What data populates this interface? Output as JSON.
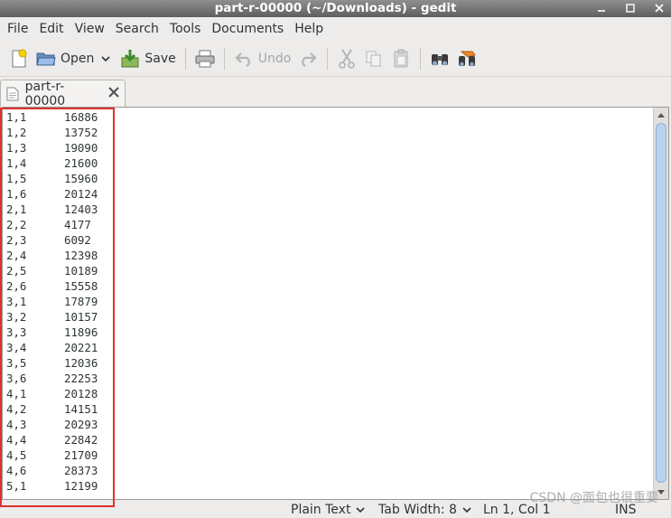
{
  "window": {
    "title": "part-r-00000 (~/Downloads) - gedit"
  },
  "menu": [
    "File",
    "Edit",
    "View",
    "Search",
    "Tools",
    "Documents",
    "Help"
  ],
  "toolbar": {
    "open_label": "Open",
    "save_label": "Save",
    "undo_label": "Undo"
  },
  "tab": {
    "label": "part-r-00000"
  },
  "document": {
    "lines": [
      {
        "k": "1,1",
        "v": "16886"
      },
      {
        "k": "1,2",
        "v": "13752"
      },
      {
        "k": "1,3",
        "v": "19090"
      },
      {
        "k": "1,4",
        "v": "21600"
      },
      {
        "k": "1,5",
        "v": "15960"
      },
      {
        "k": "1,6",
        "v": "20124"
      },
      {
        "k": "2,1",
        "v": "12403"
      },
      {
        "k": "2,2",
        "v": "4177"
      },
      {
        "k": "2,3",
        "v": "6092"
      },
      {
        "k": "2,4",
        "v": "12398"
      },
      {
        "k": "2,5",
        "v": "10189"
      },
      {
        "k": "2,6",
        "v": "15558"
      },
      {
        "k": "3,1",
        "v": "17879"
      },
      {
        "k": "3,2",
        "v": "10157"
      },
      {
        "k": "3,3",
        "v": "11896"
      },
      {
        "k": "3,4",
        "v": "20221"
      },
      {
        "k": "3,5",
        "v": "12036"
      },
      {
        "k": "3,6",
        "v": "22253"
      },
      {
        "k": "4,1",
        "v": "20128"
      },
      {
        "k": "4,2",
        "v": "14151"
      },
      {
        "k": "4,3",
        "v": "20293"
      },
      {
        "k": "4,4",
        "v": "22842"
      },
      {
        "k": "4,5",
        "v": "21709"
      },
      {
        "k": "4,6",
        "v": "28373"
      },
      {
        "k": "5,1",
        "v": "12199"
      }
    ]
  },
  "status": {
    "language": "Plain Text",
    "tab_width": "Tab Width:  8",
    "position": "Ln 1, Col 1",
    "mode": "INS"
  },
  "watermark": "CSDN @面包也很重要"
}
